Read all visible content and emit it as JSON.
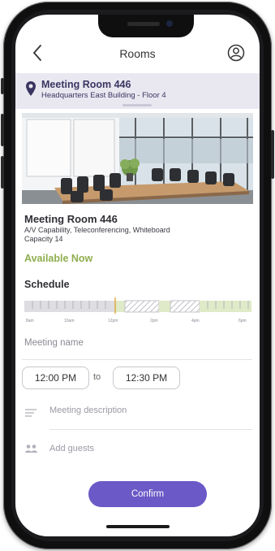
{
  "header": {
    "title": "Rooms",
    "back_icon": "chevron-left-icon",
    "profile_icon": "user-circle-icon"
  },
  "location": {
    "name": "Meeting Room 446",
    "subtitle": "Headquarters East Building - Floor 4",
    "icon": "map-pin-icon"
  },
  "room": {
    "name": "Meeting Room 446",
    "features": "A/V Capability, Teleconferencing, Whiteboard",
    "capacity": "Capacity 14",
    "availability": "Available Now"
  },
  "schedule": {
    "title": "Schedule",
    "ticks": [
      "8am",
      "10am",
      "12pm",
      "2pm",
      "4pm",
      "6pm"
    ],
    "colors": {
      "past": "#dddde2",
      "available": "#dfeac8",
      "booked_hatch": "#9a9aa3",
      "now_marker": "#e0a43a"
    }
  },
  "form": {
    "meeting_name_placeholder": "Meeting name",
    "start_time": "12:00 PM",
    "to_label": "to",
    "end_time": "12:30 PM",
    "description_placeholder": "Meeting description",
    "guests_placeholder": "Add guests",
    "confirm_label": "Confirm"
  },
  "colors": {
    "accent": "#6a59c6",
    "available_text": "#8fae4e",
    "location_bar_bg": "#e9e8f1"
  }
}
